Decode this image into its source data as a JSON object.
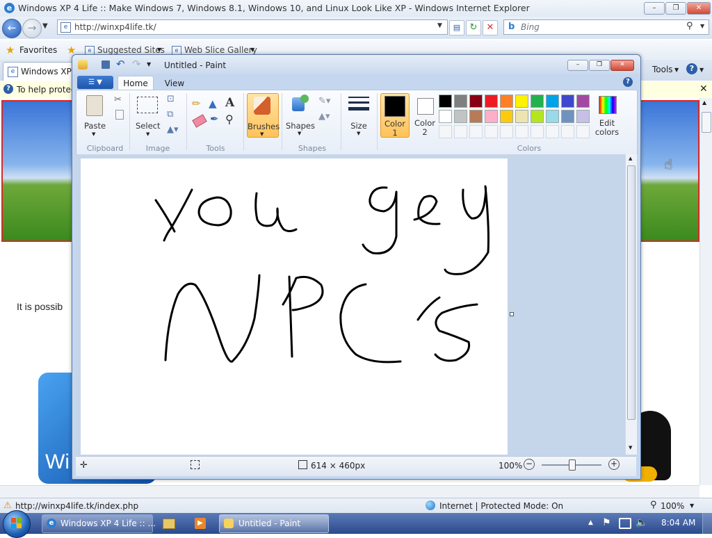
{
  "ie": {
    "title": "Windows XP 4 Life :: Make Windows 7, Windows 8.1, Windows 10, and Linux Look Like XP - Windows Internet Explorer",
    "url": "http://winxp4life.tk/",
    "search_placeholder": "Bing",
    "favorites_label": "Favorites",
    "suggested_sites": "Suggested Sites",
    "web_slice_gallery": "Web Slice Gallery",
    "tab_label": "Windows XP 4",
    "tools_label": "Tools",
    "info_bar_text": "To help protec",
    "page_text": "It is possib",
    "page_logo_text": "Wi",
    "status_url": "http://winxp4life.tk/index.php",
    "status_zone": "Internet | Protected Mode: On",
    "status_zoom": "100%"
  },
  "paint": {
    "title": "Untitled - Paint",
    "tabs": [
      "Home",
      "View"
    ],
    "groups": {
      "clipboard": "Clipboard",
      "image": "Image",
      "tools": "Tools",
      "shapes": "Shapes",
      "colors": "Colors"
    },
    "buttons": {
      "paste": "Paste",
      "select": "Select",
      "brushes": "Brushes",
      "shapes": "Shapes",
      "size": "Size",
      "color1_line1": "Color",
      "color1_line2": "1",
      "color2_line1": "Color",
      "color2_line2": "2",
      "edit_colors_line1": "Edit",
      "edit_colors_line2": "colors"
    },
    "palette_row1": [
      "#000000",
      "#7f7f7f",
      "#880015",
      "#ed1c24",
      "#ff7f27",
      "#fff200",
      "#22b14c",
      "#00a2e8",
      "#3f48cc",
      "#a349a4"
    ],
    "palette_row2": [
      "#ffffff",
      "#c3c3c3",
      "#b97a57",
      "#ffaec9",
      "#ffc90e",
      "#efe4b0",
      "#b5e61d",
      "#99d9ea",
      "#7092be",
      "#c8bfe7"
    ],
    "status_size": "614 × 460px",
    "zoom": "100%"
  },
  "taskbar": {
    "items": [
      "Windows XP 4 Life :: ...",
      "Untitled - Paint"
    ],
    "clock": "8:04 AM"
  }
}
